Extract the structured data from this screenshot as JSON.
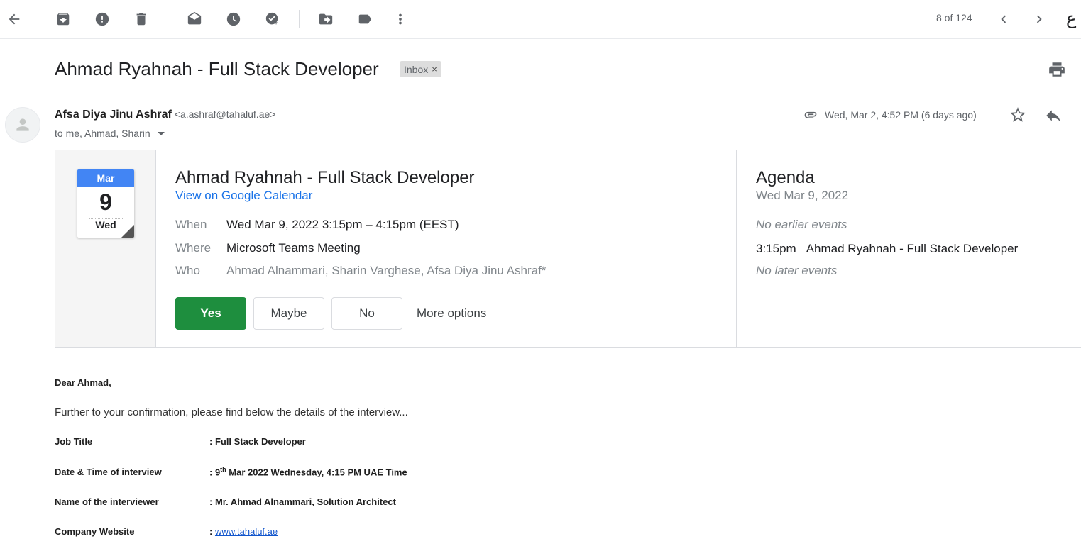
{
  "toolbar": {
    "pager": "8 of 124",
    "lang_glyph": "ع",
    "icons": [
      "back-icon",
      "archive-icon",
      "report-spam-icon",
      "delete-icon",
      "mark-unread-icon",
      "snooze-icon",
      "add-task-icon",
      "move-to-icon",
      "label-icon",
      "more-vert-icon",
      "prev-icon",
      "next-icon"
    ]
  },
  "subject": {
    "title": "Ahmad Ryahnah - Full Stack Developer",
    "label": "Inbox",
    "label_close": "×"
  },
  "sender": {
    "name": "Afsa Diya Jinu Ashraf",
    "email": "<a.ashraf@tahaluf.ae>",
    "recipients": "to me, Ahmad, Sharin",
    "date": "Wed, Mar 2, 4:52 PM (6 days ago)"
  },
  "invite": {
    "month": "Mar",
    "day": "9",
    "weekday": "Wed",
    "title": "Ahmad Ryahnah - Full Stack Developer",
    "calendar_link": "View on Google Calendar",
    "when_label": "When",
    "when_value": "Wed Mar 9, 2022 3:15pm – 4:15pm (EEST)",
    "where_label": "Where",
    "where_value": "Microsoft Teams Meeting",
    "who_label": "Who",
    "who_value": "Ahmad Alnammari, Sharin Varghese, Afsa Diya Jinu Ashraf*",
    "buttons": {
      "yes": "Yes",
      "maybe": "Maybe",
      "no": "No",
      "more": "More options"
    }
  },
  "agenda": {
    "title": "Agenda",
    "date": "Wed Mar 9, 2022",
    "no_earlier": "No earlier events",
    "event_time": "3:15pm",
    "event_title": "Ahmad Ryahnah - Full Stack Developer",
    "no_later": "No later events"
  },
  "body": {
    "greeting": "Dear Ahmad,",
    "intro": "Further to your confirmation, please find below the details of the interview...",
    "details": [
      {
        "key": "Job Title",
        "value": ": Full Stack Developer"
      },
      {
        "key": "Date & Time of interview",
        "value_prefix": ": 9",
        "value_sup": "th",
        "value_suffix": " Mar 2022 Wednesday, 4:15 PM UAE Time"
      },
      {
        "key": "Name of the interviewer",
        "value": ": Mr. Ahmad Alnammari, Solution Architect"
      },
      {
        "key": "Company Website",
        "value_prefix": ": ",
        "link": "www.tahaluf.ae"
      }
    ]
  },
  "colors": {
    "accent_blue": "#1a73e8",
    "calendar_header": "#4285f4",
    "yes_green": "#1e8e3e"
  }
}
